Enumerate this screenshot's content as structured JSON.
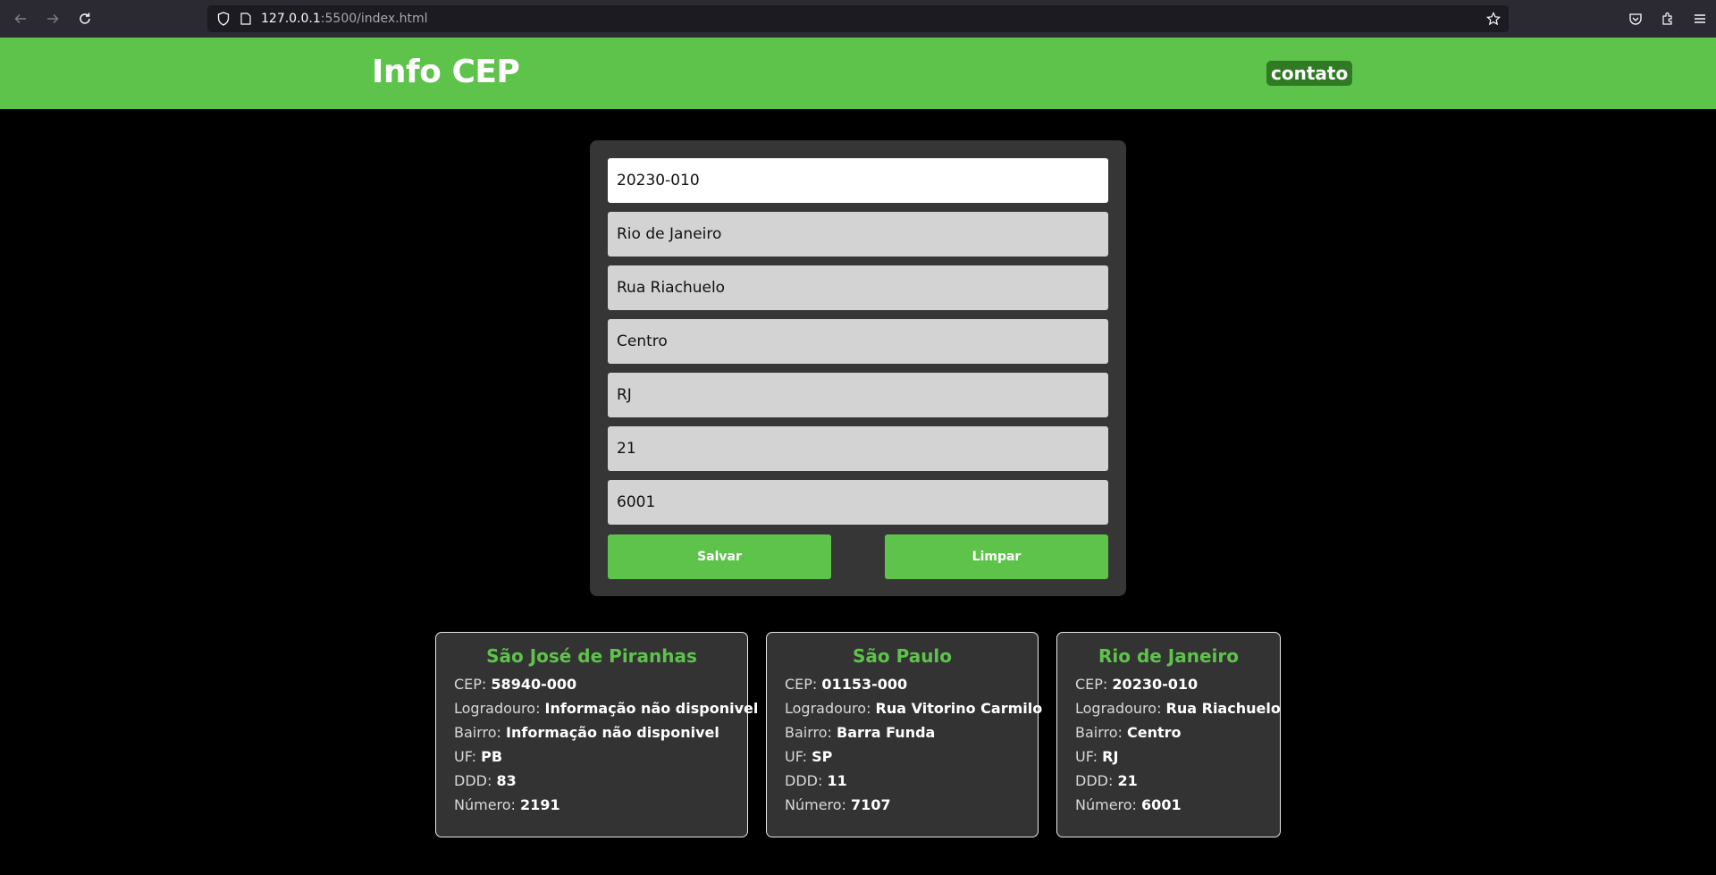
{
  "browser": {
    "url_host": "127.0.0.1",
    "url_path": ":5500/index.html"
  },
  "header": {
    "logo": "Info CEP",
    "contact_link": "contato"
  },
  "form": {
    "fields": [
      {
        "name": "cep",
        "value": "20230-010"
      },
      {
        "name": "cidade",
        "value": "Rio de Janeiro"
      },
      {
        "name": "logradouro",
        "value": "Rua Riachuelo"
      },
      {
        "name": "bairro",
        "value": "Centro"
      },
      {
        "name": "uf",
        "value": "RJ"
      },
      {
        "name": "ddd",
        "value": "21"
      },
      {
        "name": "numero",
        "value": "6001"
      }
    ],
    "save_label": "Salvar",
    "clear_label": "Limpar"
  },
  "labels": {
    "cep": "CEP:",
    "logradouro": "Logradouro:",
    "bairro": "Bairro:",
    "uf": "UF:",
    "ddd": "DDD:",
    "numero": "Número:"
  },
  "cards": [
    {
      "title": "São José de Piranhas",
      "cep": "58940-000",
      "logradouro": "Informação não disponivel",
      "bairro": "Informação não disponivel",
      "uf": "PB",
      "ddd": "83",
      "numero": "2191"
    },
    {
      "title": "São Paulo",
      "cep": "01153-000",
      "logradouro": "Rua Vitorino Carmilo",
      "bairro": "Barra Funda",
      "uf": "SP",
      "ddd": "11",
      "numero": "7107"
    },
    {
      "title": "Rio de Janeiro",
      "cep": "20230-010",
      "logradouro": "Rua Riachuelo",
      "bairro": "Centro",
      "uf": "RJ",
      "ddd": "21",
      "numero": "6001"
    }
  ],
  "colors": {
    "brand_green": "#5ec34b",
    "contact_bg": "#2f7a22",
    "card_bg": "#333333"
  }
}
